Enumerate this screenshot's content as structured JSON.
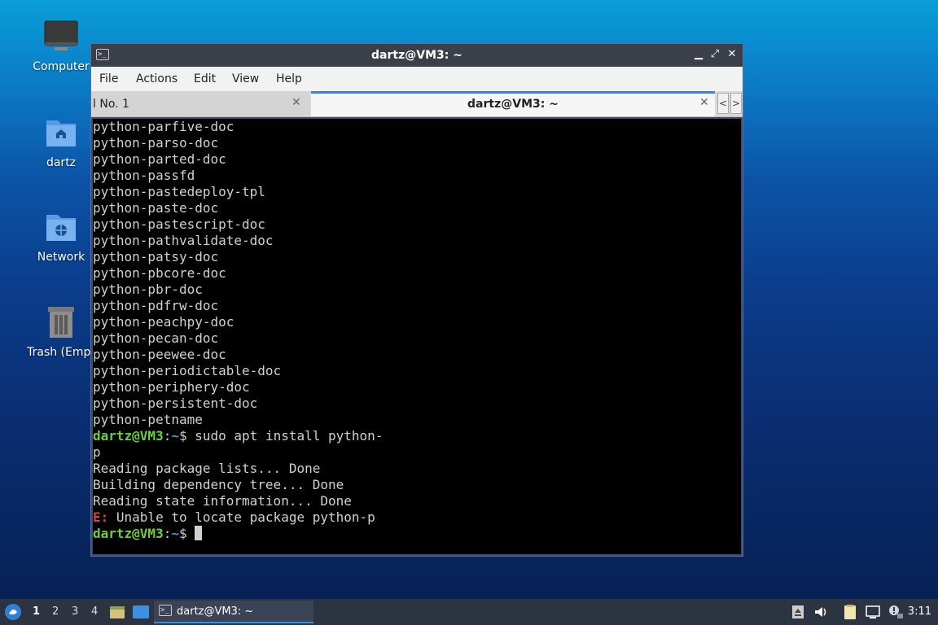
{
  "desktop": {
    "icons": [
      {
        "label": "Computer"
      },
      {
        "label": "dartz"
      },
      {
        "label": "Network"
      },
      {
        "label": "Trash (Empt"
      }
    ]
  },
  "window": {
    "title": "dartz@VM3: ~",
    "app_icon": ">_",
    "controls": {
      "minimize": "▁",
      "maximize": "⤢",
      "close": "✕"
    },
    "menu": [
      "File",
      "Actions",
      "Edit",
      "View",
      "Help"
    ],
    "tabs": [
      {
        "label": "l No. 1",
        "close": "✕"
      },
      {
        "label": "dartz@VM3: ~",
        "close": "✕"
      }
    ],
    "tab_scroll_left": "<",
    "tab_scroll_right": ">"
  },
  "terminal": {
    "lines": [
      "python-parfive-doc",
      "python-parso-doc",
      "python-parted-doc",
      "python-passfd",
      "python-pastedeploy-tpl",
      "python-paste-doc",
      "python-pastescript-doc",
      "python-pathvalidate-doc",
      "python-patsy-doc",
      "python-pbcore-doc",
      "python-pbr-doc",
      "python-pdfrw-doc",
      "python-peachpy-doc",
      "python-pecan-doc",
      "python-peewee-doc",
      "python-periodictable-doc",
      "python-periphery-doc",
      "python-persistent-doc",
      "python-petname"
    ],
    "prompt_user": "dartz@VM3",
    "prompt_sep": ":",
    "prompt_path": "~",
    "prompt_dollar": "$",
    "command": " sudo apt install python-",
    "command_wrap": "p",
    "output": [
      "Reading package lists... Done",
      "Building dependency tree... Done",
      "Reading state information... Done"
    ],
    "error_tag": "E:",
    "error_msg": " Unable to locate package python-p"
  },
  "taskbar": {
    "workspaces": [
      "1",
      "2",
      "3",
      "4"
    ],
    "active_task": "dartz@VM3: ~",
    "clock": "3:11"
  }
}
